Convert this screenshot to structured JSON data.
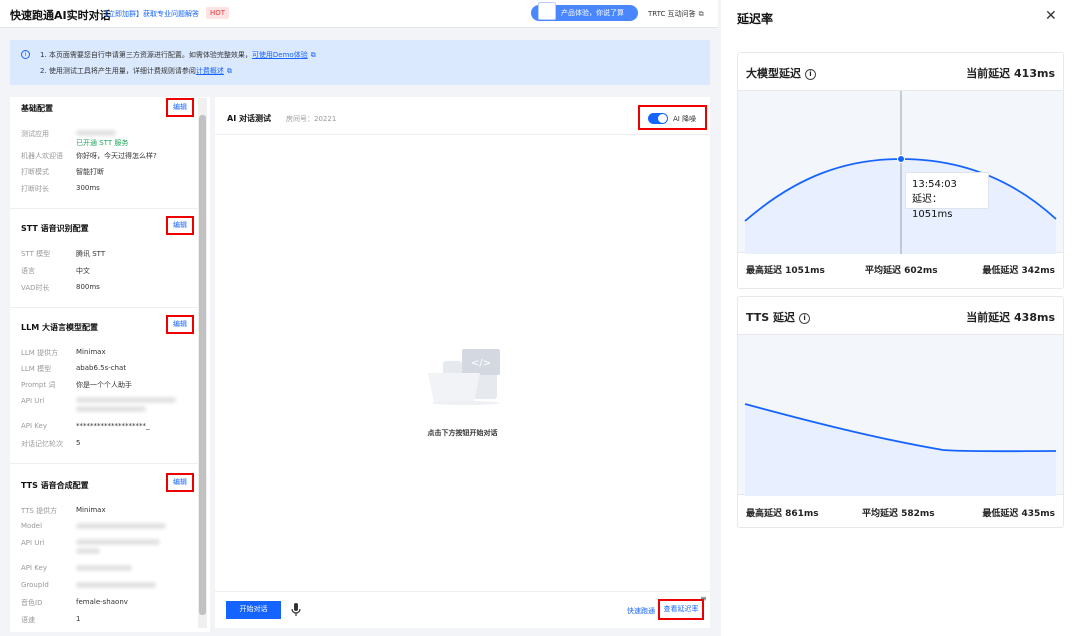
{
  "header": {
    "title": "快速跑通AI实时对话",
    "promo": "【立即加群】获取专业问题解答",
    "hot": "HOT",
    "product_pill": "产品体验，你说了算",
    "trtc_link": "TRTC 互动问答"
  },
  "notice": {
    "line1_prefix": "1. 本页面需要您自行申请第三方资源进行配置。如需体验完整效果，",
    "line1_link": "可使用Demo体验",
    "line2_prefix": "2. 使用测试工具将产生用量，详细计费规则请参阅",
    "line2_link": "计费概述"
  },
  "config": {
    "edit_label": "编辑",
    "basic": {
      "title": "基础配置",
      "items": [
        {
          "label": "测试应用",
          "value": ""
        },
        {
          "label": "",
          "value": "已开通 STT 服务"
        },
        {
          "label": "机器人欢迎语",
          "value": "你好呀，今天过得怎么样?"
        },
        {
          "label": "打断模式",
          "value": "智能打断"
        },
        {
          "label": "打断时长",
          "value": "300ms"
        }
      ]
    },
    "stt": {
      "title": "STT 语音识别配置",
      "items": [
        {
          "label": "STT 模型",
          "value": "腾讯 STT"
        },
        {
          "label": "语言",
          "value": "中文"
        },
        {
          "label": "VAD时长",
          "value": "800ms"
        }
      ]
    },
    "llm": {
      "title": "LLM 大语言模型配置",
      "items": [
        {
          "label": "LLM 提供方",
          "value": "Minimax"
        },
        {
          "label": "LLM 模型",
          "value": "abab6.5s-chat"
        },
        {
          "label": "Prompt 词",
          "value": "你是一个个人助手"
        },
        {
          "label": "API Url",
          "value": ""
        },
        {
          "label": "API Key",
          "value": "********************_"
        },
        {
          "label": "对话记忆轮次",
          "value": "5"
        }
      ]
    },
    "tts": {
      "title": "TTS 语音合成配置",
      "items": [
        {
          "label": "TTS 提供方",
          "value": "Minimax"
        },
        {
          "label": "Model",
          "value": ""
        },
        {
          "label": "API Url",
          "value": ""
        },
        {
          "label": "API Key",
          "value": ""
        },
        {
          "label": "GroupId",
          "value": ""
        },
        {
          "label": "音色ID",
          "value": "female-shaonv"
        },
        {
          "label": "语速",
          "value": "1"
        }
      ]
    }
  },
  "center": {
    "title": "AI 对话测试",
    "room": "房间号：20221",
    "toggle_label": "AI 降噪",
    "toggle_on": true,
    "empty_hint": "点击下方按钮开始对话",
    "start_button": "开始对话",
    "quick_link": "快速跑通",
    "latency_link": "查看延迟率"
  },
  "latency_panel": {
    "title": "延迟率",
    "llm": {
      "title": "大模型延迟",
      "current": "当前延迟 413ms",
      "max": "最高延迟 1051ms",
      "avg": "平均延迟 602ms",
      "min": "最低延迟 342ms",
      "tooltip_time": "13:54:03",
      "tooltip_value": "延迟：1051ms"
    },
    "tts": {
      "title": "TTS 延迟",
      "current": "当前延迟 438ms",
      "max": "最高延迟 861ms",
      "avg": "平均延迟 582ms",
      "min": "最低延迟 435ms"
    },
    "colors": {
      "line": "#1664ff",
      "fill": "#e8efff"
    }
  }
}
